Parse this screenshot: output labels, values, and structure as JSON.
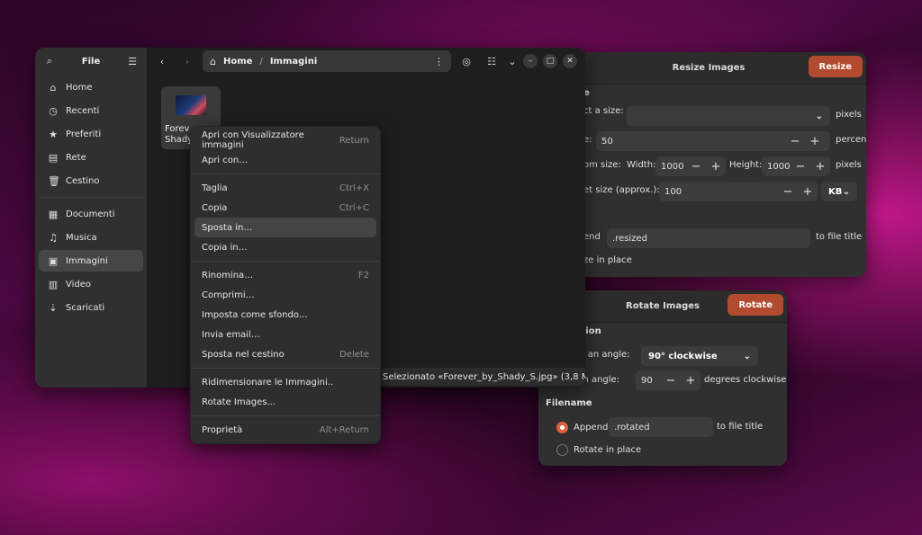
{
  "resize_dialog": {
    "title": "Resize Images",
    "action_label": "Resize",
    "section_label": "e",
    "select_size_label": "ct a size:",
    "select_size_value": "",
    "pixels_label": "pixels",
    "scale_label": "e:",
    "scale_value": "50",
    "percent_label": "percent",
    "custom_label": "om size:",
    "width_label": "Width:",
    "width_value": "1000",
    "height_label": "Height:",
    "height_value": "1000",
    "target_label": "et size (approx.):",
    "target_value": "100",
    "target_unit": "KB",
    "append_label": "end",
    "append_value": ".resized",
    "to_file_title": "to file title",
    "in_place_label": "ze in place",
    "minus": "−",
    "plus": "+"
  },
  "rotate_dialog": {
    "title": "Rotate Images",
    "action_label": "Rotate",
    "section_label": "tation",
    "select_angle_label": "ect an angle:",
    "select_angle_value": "90° clockwise",
    "custom_angle_label": "tom angle:",
    "custom_angle_value": "90",
    "degrees_label": "degrees clockwise",
    "filename_label": "Filename",
    "append_label": "Append",
    "append_value": ".rotated",
    "to_file_title": "to file title",
    "in_place_label": "Rotate in place"
  },
  "file_manager": {
    "sidebar_title": "File",
    "sidebar_items": [
      {
        "label": "Home",
        "icon": "home-icon"
      },
      {
        "label": "Recenti",
        "icon": "clock-icon"
      },
      {
        "label": "Preferiti",
        "icon": "star-icon"
      },
      {
        "label": "Rete",
        "icon": "network-icon"
      },
      {
        "label": "Cestino",
        "icon": "trash-icon"
      },
      {
        "label": "Documenti",
        "icon": "document-icon"
      },
      {
        "label": "Musica",
        "icon": "music-icon"
      },
      {
        "label": "Immagini",
        "icon": "image-icon"
      },
      {
        "label": "Video",
        "icon": "video-icon"
      },
      {
        "label": "Scaricati",
        "icon": "download-icon"
      }
    ],
    "path_home": "Home",
    "path_sep": "/",
    "path_current": "Immagini",
    "file_name_line1": "Forev",
    "file_name_line2": "Shady",
    "status": "Selezionato «Forever_by_Shady_S.jpg» (3,8 MB)"
  },
  "context_menu": {
    "items": [
      {
        "label": "Apri con Visualizzatore immagini",
        "accel": "Return"
      },
      {
        "label": "Apri con…",
        "accel": ""
      },
      {
        "label": "Taglia",
        "accel": "Ctrl+X"
      },
      {
        "label": "Copia",
        "accel": "Ctrl+C"
      },
      {
        "label": "Sposta in…",
        "accel": ""
      },
      {
        "label": "Copia in…",
        "accel": ""
      },
      {
        "label": "Rinomina…",
        "accel": "F2"
      },
      {
        "label": "Comprimi…",
        "accel": ""
      },
      {
        "label": "Imposta come sfondo…",
        "accel": ""
      },
      {
        "label": "Invia email…",
        "accel": ""
      },
      {
        "label": "Sposta nel cestino",
        "accel": "Delete"
      },
      {
        "label": "Ridimensionare le Immagini..",
        "accel": ""
      },
      {
        "label": "Rotate Images...",
        "accel": ""
      },
      {
        "label": "Proprietà",
        "accel": "Alt+Return"
      }
    ]
  },
  "colors": {
    "accent": "#b14a2e",
    "radio_on": "#e0613c"
  }
}
